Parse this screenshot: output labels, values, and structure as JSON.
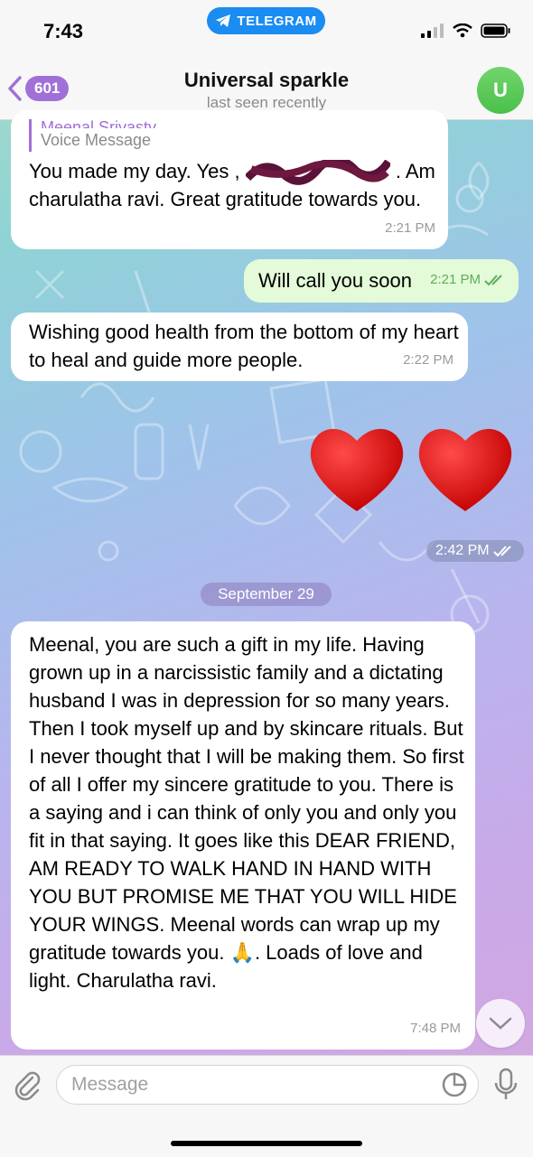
{
  "status": {
    "time": "7:43",
    "app_pill": "TELEGRAM"
  },
  "header": {
    "back_count": "601",
    "title": "Universal sparkle",
    "subtitle": "last seen recently",
    "avatar_initial": "U"
  },
  "messages": [
    {
      "direction": "in",
      "reply_name": "Meenal Srivastv",
      "reply_text": "Voice Message",
      "text_before": "You made my day. Yes ,",
      "text_after": ". Am charulatha ravi. Great gratitude towards you.",
      "time": "2:21 PM"
    },
    {
      "direction": "out",
      "text": "Will call you soon",
      "time": "2:21 PM",
      "read": true
    },
    {
      "direction": "in",
      "text": "Wishing good health from the bottom of my heart to heal and guide more people.",
      "time": "2:22 PM"
    },
    {
      "direction": "out",
      "emoji": "❤️❤️",
      "time": "2:42 PM",
      "read": true
    },
    {
      "direction": "in",
      "text": "Meenal, you are such a gift in my life. Having grown up in a narcissistic family and a dictating husband I was in depression for so many years. Then I took myself up and by skincare rituals. But I never thought that I will be making them. So first of all I offer my sincere gratitude to you. There is a saying and i can think of only you and only you fit in that saying. It goes like this DEAR FRIEND, AM READY TO WALK HAND IN HAND WITH YOU BUT PROMISE ME THAT YOU WILL HIDE YOUR WINGS.  Meenal words can wrap up my gratitude towards you. 🙏. Loads of love and light. Charulatha ravi.",
      "time": "7:48 PM"
    }
  ],
  "date_separator": "September 29",
  "input": {
    "placeholder": "Message"
  },
  "colors": {
    "accent": "#a070d8",
    "outgoing_bubble": "#e3fbd8",
    "telegram_blue": "#1a8cf2"
  },
  "icons": [
    "telegram-plane-icon",
    "signal-icon",
    "wifi-icon",
    "battery-icon",
    "back-chevron-icon",
    "attach-icon",
    "sticker-icon",
    "mic-icon",
    "chevron-down-icon",
    "read-checks-icon"
  ]
}
